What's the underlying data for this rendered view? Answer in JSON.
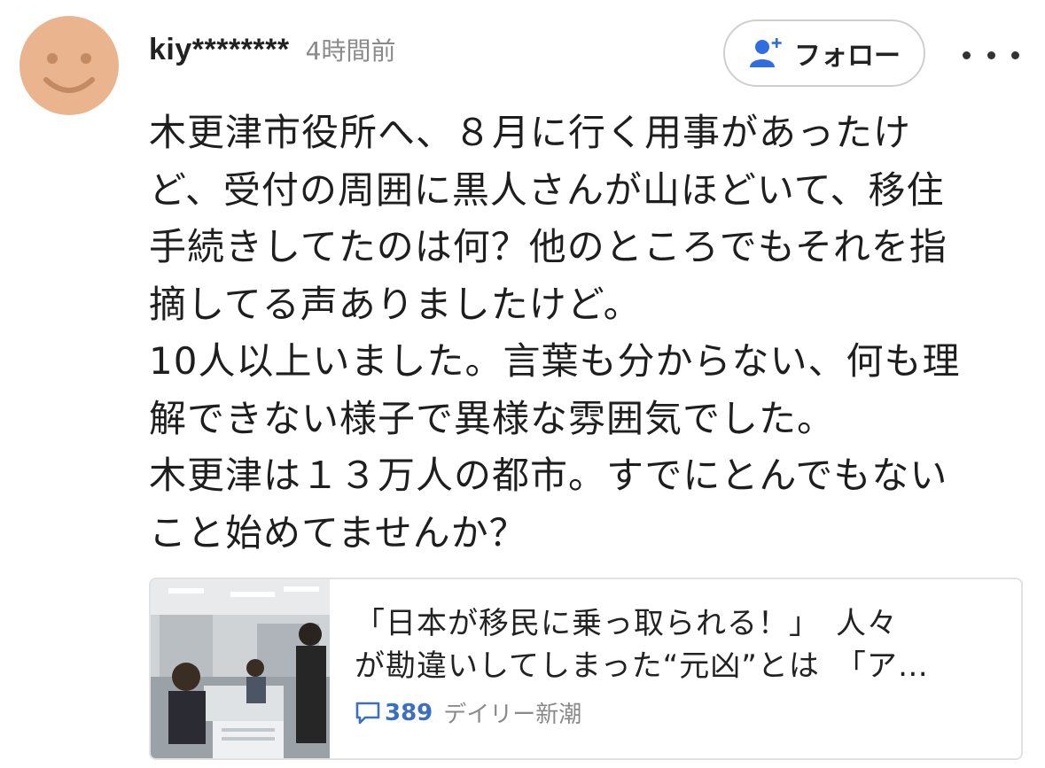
{
  "post": {
    "username": "kiy********",
    "timestamp": "4時間前",
    "follow_label": "フォロー",
    "body_lines": [
      "木更津市役所へ、８月に行く用事があったけ",
      "ど、受付の周囲に黒人さんが山ほどいて、移住",
      "手続きしてたのは何？他のところでもそれを指",
      "摘してる声ありましたけど。",
      "10人以上いました。言葉も分からない、何も理",
      "解できない様子で異様な雰囲気でした。",
      "木更津は１３万人の都市。すでにとんでもない",
      "こと始めてませんか？"
    ]
  },
  "link_card": {
    "title_lines": [
      "「日本が移民に乗っ取られる！」　人々",
      "が勘違いしてしまった“元凶”とは　「ア…"
    ],
    "comment_count": "389",
    "source": "デイリー新潮"
  },
  "icons": {
    "avatar": "smiley-face-avatar",
    "follow": "add-user-icon",
    "more": "more-horizontal-icon",
    "comment": "speech-bubble-icon"
  },
  "colors": {
    "avatar_bg": "#e9b48e",
    "follow_icon": "#2f6de1",
    "comment_accent": "#3a6fc2"
  }
}
